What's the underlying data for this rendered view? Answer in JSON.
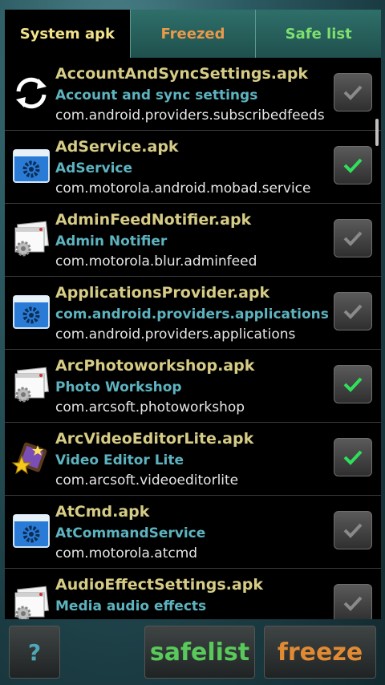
{
  "tabs": [
    {
      "label": "System apk",
      "active": true
    },
    {
      "label": "Freezed",
      "active": false
    },
    {
      "label": "Safe list",
      "active": false
    }
  ],
  "apps": [
    {
      "file": "AccountAndSyncSettings.apk",
      "label": "Account and sync settings",
      "package": "com.android.providers.subscribedfeeds",
      "icon": "sync-icon",
      "checked": false
    },
    {
      "file": "AdService.apk",
      "label": "AdService",
      "package": "com.motorola.android.mobad.service",
      "icon": "settings-window-icon",
      "checked": true
    },
    {
      "file": "AdminFeedNotifier.apk",
      "label": "Admin Notifier",
      "package": "com.motorola.blur.adminfeed",
      "icon": "app-window-gear-icon",
      "checked": false
    },
    {
      "file": "ApplicationsProvider.apk",
      "label": "com.android.providers.applications",
      "package": "com.android.providers.applications",
      "icon": "settings-window-icon",
      "checked": false
    },
    {
      "file": "ArcPhotoworkshop.apk",
      "label": "Photo Workshop",
      "package": "com.arcsoft.photoworkshop",
      "icon": "app-window-gear-icon",
      "checked": true
    },
    {
      "file": "ArcVideoEditorLite.apk",
      "label": "Video Editor Lite",
      "package": "com.arcsoft.videoeditorlite",
      "icon": "video-editor-icon",
      "checked": true
    },
    {
      "file": "AtCmd.apk",
      "label": "AtCommandService",
      "package": "com.motorola.atcmd",
      "icon": "settings-window-icon",
      "checked": false
    },
    {
      "file": "AudioEffectSettings.apk",
      "label": "Media audio effects",
      "package": "",
      "icon": "app-window-gear-icon",
      "checked": false
    }
  ],
  "buttons": {
    "help": "?",
    "safelist": "safelist",
    "freeze": "freeze"
  },
  "colors": {
    "checked": "#2fe05a",
    "unchecked": "#8a8a8a",
    "file_name": "#d6cc86",
    "app_label": "#5db3bf"
  }
}
